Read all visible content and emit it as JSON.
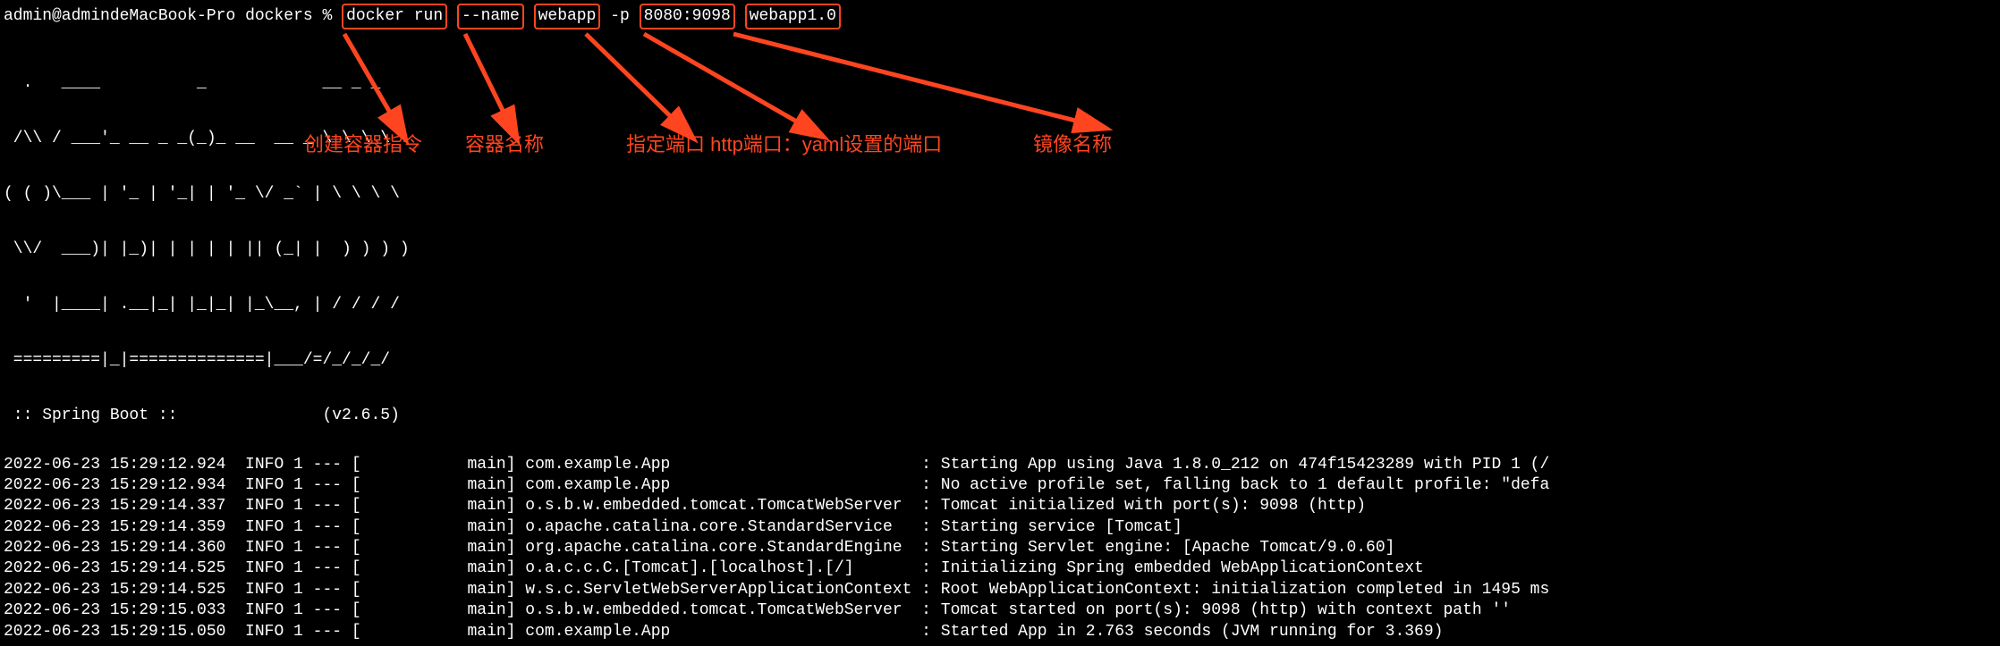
{
  "prompt": {
    "user_host": "admin@admindeMacBook-Pro",
    "cwd": "dockers",
    "symbol": "%",
    "cmd_docker_run": "docker run",
    "cmd_name_flag": "--name",
    "cmd_name_value": "webapp",
    "cmd_p_flag": "-p",
    "cmd_ports": "8080:9098",
    "cmd_image": "webapp1.0"
  },
  "ascii": {
    "line1": "  .   ____          _            __ _ _",
    "line2": " /\\\\ / ___'_ __ _ _(_)_ __  __ _ \\ \\ \\ \\",
    "line3": "( ( )\\___ | '_ | '_| | '_ \\/ _` | \\ \\ \\ \\",
    "line4": " \\\\/  ___)| |_)| | | | | || (_| |  ) ) ) )",
    "line5": "  '  |____| .__|_| |_|_| |_\\__, | / / / /",
    "line6": " =========|_|==============|___/=/_/_/_/",
    "line7": " :: Spring Boot ::               (v2.6.5)"
  },
  "annotations": {
    "create_cmd": "创建容器指令",
    "container_name": "容器名称",
    "port_spec": "指定端口 http端口：yaml设置的端口",
    "image_name": "镜像名称"
  },
  "logs": [
    {
      "ts": "2022-06-23 15:29:12.924",
      "lvl": "INFO",
      "pid": "1",
      "sep": "---",
      "thread": "[           main]",
      "logger": "com.example.App                         ",
      "msg": "Starting App using Java 1.8.0_212 on 474f15423289 with PID 1 (/"
    },
    {
      "ts": "2022-06-23 15:29:12.934",
      "lvl": "INFO",
      "pid": "1",
      "sep": "---",
      "thread": "[           main]",
      "logger": "com.example.App                         ",
      "msg": "No active profile set, falling back to 1 default profile: \"defa"
    },
    {
      "ts": "2022-06-23 15:29:14.337",
      "lvl": "INFO",
      "pid": "1",
      "sep": "---",
      "thread": "[           main]",
      "logger": "o.s.b.w.embedded.tomcat.TomcatWebServer ",
      "msg": "Tomcat initialized with port(s): 9098 (http)"
    },
    {
      "ts": "2022-06-23 15:29:14.359",
      "lvl": "INFO",
      "pid": "1",
      "sep": "---",
      "thread": "[           main]",
      "logger": "o.apache.catalina.core.StandardService  ",
      "msg": "Starting service [Tomcat]"
    },
    {
      "ts": "2022-06-23 15:29:14.360",
      "lvl": "INFO",
      "pid": "1",
      "sep": "---",
      "thread": "[           main]",
      "logger": "org.apache.catalina.core.StandardEngine ",
      "msg": "Starting Servlet engine: [Apache Tomcat/9.0.60]"
    },
    {
      "ts": "2022-06-23 15:29:14.525",
      "lvl": "INFO",
      "pid": "1",
      "sep": "---",
      "thread": "[           main]",
      "logger": "o.a.c.c.C.[Tomcat].[localhost].[/]      ",
      "msg": "Initializing Spring embedded WebApplicationContext"
    },
    {
      "ts": "2022-06-23 15:29:14.525",
      "lvl": "INFO",
      "pid": "1",
      "sep": "---",
      "thread": "[           main]",
      "logger": "w.s.c.ServletWebServerApplicationContext",
      "msg": "Root WebApplicationContext: initialization completed in 1495 ms"
    },
    {
      "ts": "2022-06-23 15:29:15.033",
      "lvl": "INFO",
      "pid": "1",
      "sep": "---",
      "thread": "[           main]",
      "logger": "o.s.b.w.embedded.tomcat.TomcatWebServer ",
      "msg": "Tomcat started on port(s): 9098 (http) with context path ''"
    },
    {
      "ts": "2022-06-23 15:29:15.050",
      "lvl": "INFO",
      "pid": "1",
      "sep": "---",
      "thread": "[           main]",
      "logger": "com.example.App                         ",
      "msg": "Started App in 2.763 seconds (JVM running for 3.369)"
    }
  ]
}
